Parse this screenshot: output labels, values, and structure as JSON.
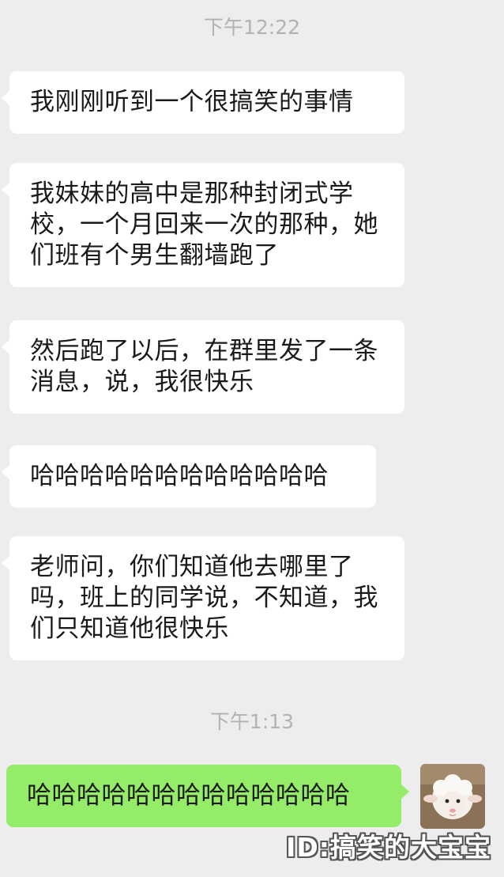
{
  "chat": {
    "time_1": "下午12:22",
    "time_2": "下午1:13",
    "messages": [
      {
        "sender": "other",
        "text": "我刚刚听到一个很搞笑的事情"
      },
      {
        "sender": "other",
        "text": "我妹妹的高中是那种封闭式学校，一个月回来一次的那种，她们班有个男生翻墙跑了"
      },
      {
        "sender": "other",
        "text": "然后跑了以后，在群里发了一条消息，说，我很快乐"
      },
      {
        "sender": "other",
        "text": "哈哈哈哈哈哈哈哈哈哈哈哈"
      },
      {
        "sender": "other",
        "text": "老师问，你们知道他去哪里了吗，班上的同学说，不知道，我们只知道他很快乐"
      },
      {
        "sender": "self",
        "text": "哈哈哈哈哈哈哈哈哈哈哈哈哈"
      }
    ]
  },
  "watermark": "ID:搞笑的大宝宝",
  "colors": {
    "background": "#ededed",
    "bubble_incoming": "#ffffff",
    "bubble_outgoing": "#95ec69",
    "timestamp": "#b2b2b2"
  },
  "avatar": {
    "icon": "sheep-plush-avatar"
  }
}
